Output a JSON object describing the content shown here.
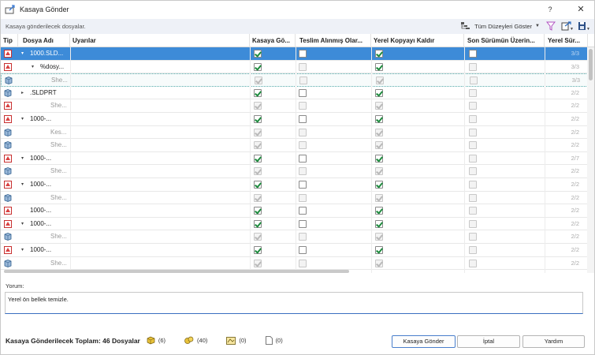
{
  "window": {
    "title": "Kasaya Gönder",
    "help": "?",
    "close": "✕"
  },
  "toolbar": {
    "subtitle": "Kasaya gönderilecek dosyalar.",
    "levels_label": "Tüm Düzeyleri Göster"
  },
  "columns": [
    "Tip",
    "Dosya Adı",
    "Uyarılar",
    "Kasaya Gö...",
    "Teslim Alınmış Olar...",
    "Yerel Kopyayı Kaldır",
    "Son Sürümün Üzerin...",
    "Yerel Sür..."
  ],
  "rows": [
    {
      "icon": "part-red",
      "expander": "▾",
      "name": "1000.SLD...",
      "indent": 1,
      "selected": true,
      "focus": false,
      "dim": false,
      "c1": "on",
      "c2": "off",
      "c3": "on",
      "c4": "off",
      "count": "3/3"
    },
    {
      "icon": "part-red",
      "expander": "▾",
      "name": "%dosy...",
      "indent": 2,
      "selected": false,
      "focus": false,
      "dim": false,
      "c1": "on",
      "c2": "off-dis",
      "c3": "on",
      "c4": "off-dis",
      "count": "3/3"
    },
    {
      "icon": "drawing-blue",
      "expander": "",
      "name": "She...",
      "indent": 3,
      "selected": false,
      "focus": true,
      "dim": true,
      "c1": "on-dis",
      "c2": "off-dis",
      "c3": "on-dis",
      "c4": "off-dis",
      "count": "3/3"
    },
    {
      "icon": "drawing-blue",
      "expander": "▸",
      "name": ".SLDPRT",
      "indent": 1,
      "selected": false,
      "focus": false,
      "dim": false,
      "c1": "on",
      "c2": "off",
      "c3": "on",
      "c4": "off-dis",
      "count": "2/2"
    },
    {
      "icon": "part-red",
      "expander": "",
      "name": "She...",
      "indent": 3,
      "selected": false,
      "focus": false,
      "dim": true,
      "c1": "on-dis",
      "c2": "off-dis",
      "c3": "on-dis",
      "c4": "off-dis",
      "count": "2/2"
    },
    {
      "icon": "part-red",
      "expander": "▾",
      "name": "1000-...",
      "indent": 1,
      "selected": false,
      "focus": false,
      "dim": false,
      "c1": "on",
      "c2": "off",
      "c3": "on",
      "c4": "off-dis",
      "count": "2/2"
    },
    {
      "icon": "drawing-blue",
      "expander": "",
      "name": "Kes...",
      "indent": 3,
      "selected": false,
      "focus": false,
      "dim": true,
      "c1": "on-dis",
      "c2": "off-dis",
      "c3": "on-dis",
      "c4": "off-dis",
      "count": "2/2"
    },
    {
      "icon": "drawing-blue",
      "expander": "",
      "name": "She...",
      "indent": 3,
      "selected": false,
      "focus": false,
      "dim": true,
      "c1": "on-dis",
      "c2": "off-dis",
      "c3": "on-dis",
      "c4": "off-dis",
      "count": "2/2"
    },
    {
      "icon": "part-red",
      "expander": "▾",
      "name": "1000-...",
      "indent": 1,
      "selected": false,
      "focus": false,
      "dim": false,
      "c1": "on",
      "c2": "off",
      "c3": "on",
      "c4": "off-dis",
      "count": "2/7"
    },
    {
      "icon": "drawing-blue",
      "expander": "",
      "name": "She...",
      "indent": 3,
      "selected": false,
      "focus": false,
      "dim": true,
      "c1": "on-dis",
      "c2": "off-dis",
      "c3": "on-dis",
      "c4": "off-dis",
      "count": "2/2"
    },
    {
      "icon": "part-red",
      "expander": "▾",
      "name": "1000-...",
      "indent": 1,
      "selected": false,
      "focus": false,
      "dim": false,
      "c1": "on",
      "c2": "off",
      "c3": "on",
      "c4": "off-dis",
      "count": "2/2"
    },
    {
      "icon": "drawing-blue",
      "expander": "",
      "name": "She...",
      "indent": 3,
      "selected": false,
      "focus": false,
      "dim": true,
      "c1": "on-dis",
      "c2": "off-dis",
      "c3": "on-dis",
      "c4": "off-dis",
      "count": "2/2"
    },
    {
      "icon": "part-red",
      "expander": "",
      "name": "1000-...",
      "indent": 1,
      "selected": false,
      "focus": false,
      "dim": false,
      "c1": "on",
      "c2": "off",
      "c3": "on",
      "c4": "off-dis",
      "count": "2/2"
    },
    {
      "icon": "part-red",
      "expander": "▾",
      "name": "1000-...",
      "indent": 1,
      "selected": false,
      "focus": false,
      "dim": false,
      "c1": "on",
      "c2": "off",
      "c3": "on",
      "c4": "off-dis",
      "count": "2/2"
    },
    {
      "icon": "drawing-blue",
      "expander": "",
      "name": "She...",
      "indent": 3,
      "selected": false,
      "focus": false,
      "dim": true,
      "c1": "on-dis",
      "c2": "off-dis",
      "c3": "on-dis",
      "c4": "off-dis",
      "count": "2/2"
    },
    {
      "icon": "part-red",
      "expander": "▾",
      "name": "1000-...",
      "indent": 1,
      "selected": false,
      "focus": false,
      "dim": false,
      "c1": "on",
      "c2": "off",
      "c3": "on",
      "c4": "off-dis",
      "count": "2/2"
    },
    {
      "icon": "drawing-blue",
      "expander": "",
      "name": "She...",
      "indent": 3,
      "selected": false,
      "focus": false,
      "dim": true,
      "c1": "on-dis",
      "c2": "off-dis",
      "c3": "on-dis",
      "c4": "off-dis",
      "count": "2/2"
    }
  ],
  "comment": {
    "label": "Yorum:",
    "value": "Yerel ön bellek temizle."
  },
  "footer": {
    "total": "Kasaya Gönderilecek Toplam:  46 Dosyalar",
    "stats": [
      {
        "icon": "part-icon",
        "value": "(6)"
      },
      {
        "icon": "assembly-icon",
        "value": "(40)"
      },
      {
        "icon": "drawing-icon",
        "value": "(0)"
      },
      {
        "icon": "document-icon",
        "value": "(0)"
      }
    ]
  },
  "buttons": {
    "submit": "Kasaya Gönder",
    "cancel": "İptal",
    "help": "Yardım"
  },
  "colors": {
    "selection": "#3d8bd8",
    "toolbar_bg": "#eef1f7",
    "check": "#1d8a3d"
  }
}
